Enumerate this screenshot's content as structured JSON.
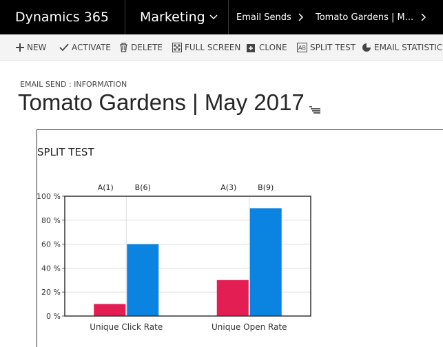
{
  "topbar": {
    "brand": "Dynamics 365",
    "module": "Marketing",
    "breadcrumb": [
      "Email Sends",
      "Tomato Gardens | M..."
    ]
  },
  "commands": [
    {
      "label": "NEW",
      "icon": "plus-icon"
    },
    {
      "label": "ACTIVATE",
      "icon": "checkmark-icon"
    },
    {
      "label": "DELETE",
      "icon": "trash-icon"
    },
    {
      "label": "FULL SCREEN",
      "icon": "full-screen-icon"
    },
    {
      "label": "CLONE",
      "icon": "clone-icon"
    },
    {
      "label": "SPLIT TEST",
      "icon": "split-test-icon"
    },
    {
      "label": "EMAIL STATISTICS",
      "icon": "pie-chart-icon"
    }
  ],
  "header": {
    "entity_label": "EMAIL SEND : INFORMATION",
    "record_title": "Tomato Gardens | May 2017"
  },
  "section": {
    "title": "SPLIT TEST"
  },
  "colors": {
    "variant_a": "#e31e52",
    "variant_b": "#0a84e0"
  },
  "chart_data": {
    "type": "bar",
    "categories": [
      "Unique Click Rate",
      "Unique Open Rate"
    ],
    "series": [
      {
        "values": [
          10,
          30
        ],
        "labels": [
          "A(1)",
          "A(3)"
        ]
      },
      {
        "values": [
          60,
          90
        ],
        "labels": [
          "B(6)",
          "B(9)"
        ]
      }
    ],
    "ylim": [
      0,
      100
    ],
    "yticks": [
      "0 %",
      "20 %",
      "40 %",
      "60 %",
      "80 %",
      "100 %"
    ],
    "grid": true
  }
}
